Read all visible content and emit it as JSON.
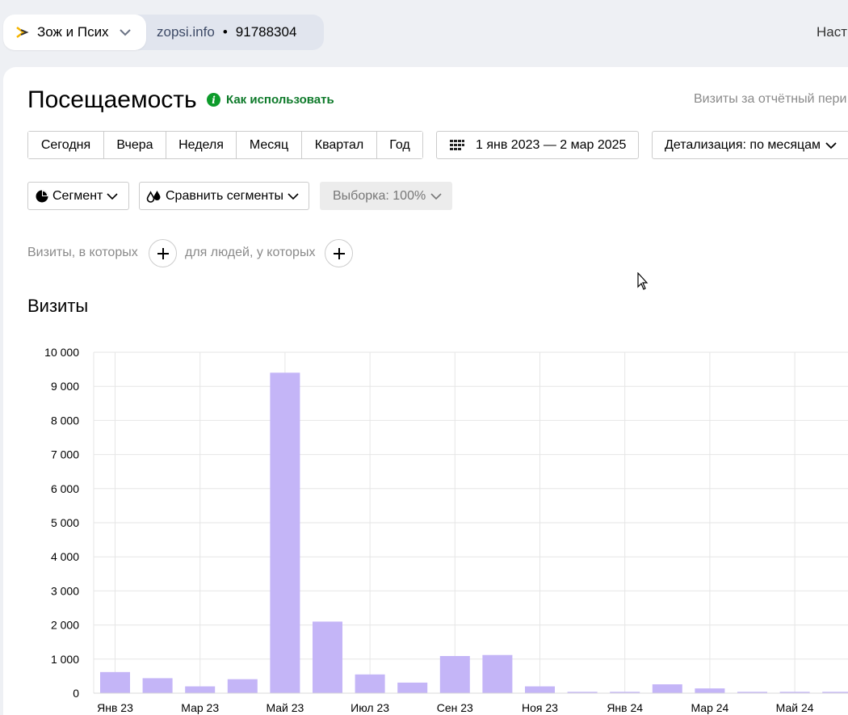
{
  "counter": {
    "name": "Зож и Псих",
    "site": "zopsi.info",
    "separator": "•",
    "id": "91788304"
  },
  "top_right_link": "Наст",
  "page": {
    "title": "Посещаемость",
    "howto_label": "Как использовать",
    "period_hint": "Визиты за отчётный пери"
  },
  "periods": [
    "Сегодня",
    "Вчера",
    "Неделя",
    "Месяц",
    "Квартал",
    "Год"
  ],
  "date_range": "1 янв 2023 — 2 мар 2025",
  "detail_label": "Детализация: по месяцам",
  "segment_label": "Сегмент",
  "compare_label": "Сравнить сегменты",
  "sample_label": "Выборка: 100%",
  "filters": {
    "visits_label": "Визиты, в которых",
    "people_label": "для людей, у которых"
  },
  "section_title": "Визиты",
  "colors": {
    "bar": "#c4b5f7",
    "howto": "#0e7a2a",
    "grid": "#e6e6e6"
  },
  "chart_data": {
    "type": "bar",
    "title": "",
    "xlabel": "",
    "ylabel": "",
    "ylim": [
      0,
      10000
    ],
    "y_ticks": [
      "0",
      "1 000",
      "2 000",
      "3 000",
      "4 000",
      "5 000",
      "6 000",
      "7 000",
      "8 000",
      "9 000",
      "10 000"
    ],
    "categories": [
      "Янв 23",
      "Фев 23",
      "Мар 23",
      "Апр 23",
      "Май 23",
      "Июн 23",
      "Июл 23",
      "Авг 23",
      "Сен 23",
      "Окт 23",
      "Ноя 23",
      "Дек 23",
      "Янв 24",
      "Фев 24",
      "Мар 24",
      "Апр 24",
      "Май 24",
      "Июн 24"
    ],
    "x_tick_labels": [
      "Янв 23",
      "Мар 23",
      "Май 23",
      "Июл 23",
      "Сен 23",
      "Ноя 23",
      "Янв 24",
      "Мар 24",
      "Май 24"
    ],
    "values": [
      620,
      440,
      200,
      410,
      9400,
      2100,
      550,
      310,
      1090,
      1120,
      200,
      40,
      40,
      260,
      140,
      40,
      40,
      40
    ],
    "grid": true
  }
}
